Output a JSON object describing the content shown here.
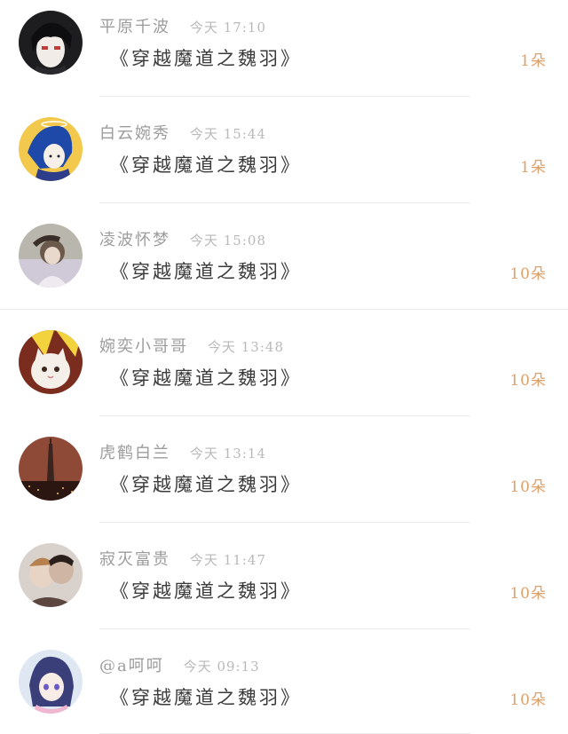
{
  "accent_color": "#e0a06a",
  "items": [
    {
      "name": "平原千波",
      "time": "今天 17:10",
      "title": "《穿越魔道之魏羽》",
      "count": "1朵",
      "avatar": "avatar-black-hair-anime"
    },
    {
      "name": "白云婉秀",
      "time": "今天 15:44",
      "title": "《穿越魔道之魏羽》",
      "count": "1朵",
      "avatar": "avatar-blue-hair-anime"
    },
    {
      "name": "凌波怀梦",
      "time": "今天 15:08",
      "title": "《穿越魔道之魏羽》",
      "count": "10朵",
      "avatar": "avatar-girl-photo"
    },
    {
      "name": "婉奕小哥哥",
      "time": "今天 13:48",
      "title": "《穿越魔道之魏羽》",
      "count": "10朵",
      "avatar": "avatar-cat-photo"
    },
    {
      "name": "虎鹤白兰",
      "time": "今天 13:14",
      "title": "《穿越魔道之魏羽》",
      "count": "10朵",
      "avatar": "avatar-city-tower-photo"
    },
    {
      "name": "寂灭富贵",
      "time": "今天 11:47",
      "title": "《穿越魔道之魏羽》",
      "count": "10朵",
      "avatar": "avatar-couple-photo"
    },
    {
      "name": "@a呵呵",
      "time": "今天 09:13",
      "title": "《穿越魔道之魏羽》",
      "count": "10朵",
      "avatar": "avatar-purple-hair-anime"
    }
  ]
}
